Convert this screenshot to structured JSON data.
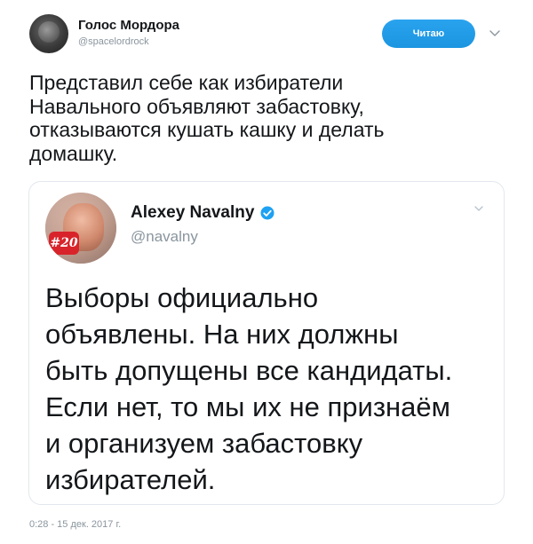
{
  "author": {
    "display_name": "Голос Мордора",
    "handle": "@spacelordrock"
  },
  "follow_button": {
    "label": "Читаю"
  },
  "tweet": {
    "text": "Представил себе как избиратели\nНавального объявляют забастовку,\nотказываются кушать кашку и делать\nдомашку."
  },
  "quoted_tweet": {
    "display_name": "Alexey Navalny",
    "handle": "@navalny",
    "avatar_badge": "#20",
    "text": "Выборы официально\nобъявлены. На них должны\nбыть допущены все кандидаты.\nЕсли нет, то мы их не признаём\nи организуем забастовку\nизбирателей."
  },
  "timestamp": "0:28 - 15 дек. 2017 г.",
  "icons": {
    "caret": "chevron-down-icon",
    "verified": "verified-badge-icon"
  },
  "colors": {
    "accent": "#1b95e0",
    "verified": "#1da1f2",
    "muted_text": "#8a959e",
    "border": "#e1e8ed"
  }
}
